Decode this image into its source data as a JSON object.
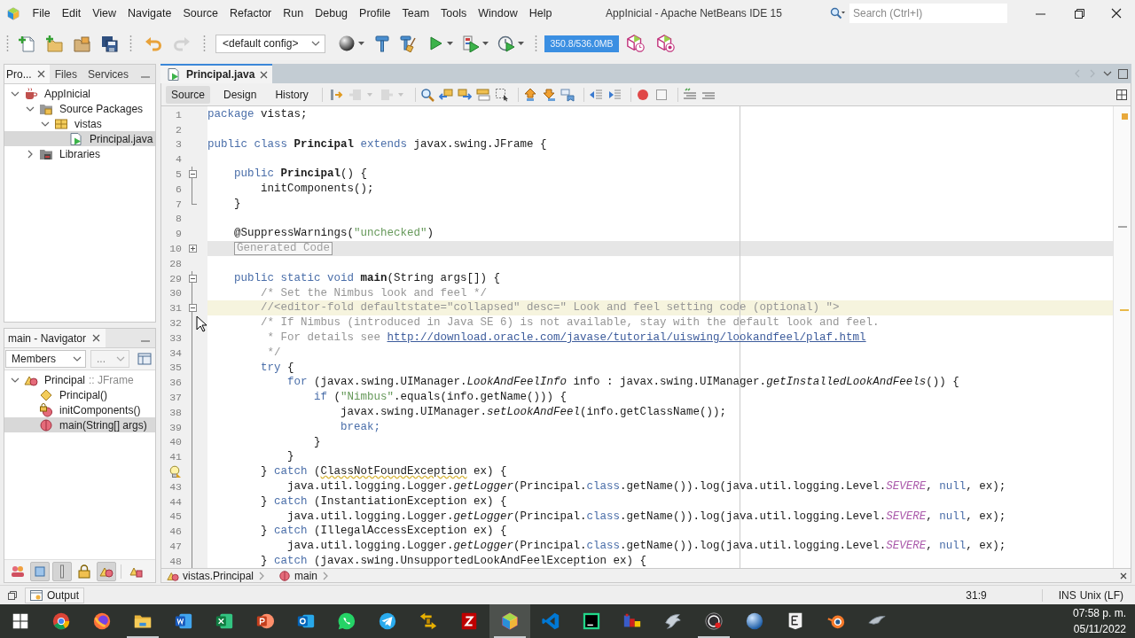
{
  "window": {
    "title": "AppInicial - Apache NetBeans IDE 15",
    "search": {
      "placeholder": "Search (Ctrl+I)"
    }
  },
  "menu": [
    "File",
    "Edit",
    "View",
    "Navigate",
    "Source",
    "Refactor",
    "Run",
    "Debug",
    "Profile",
    "Team",
    "Tools",
    "Window",
    "Help"
  ],
  "toolbar": {
    "buttons": [
      {
        "kind": "newfile",
        "disabled": false
      },
      {
        "kind": "newproject",
        "disabled": false
      },
      {
        "kind": "openproject",
        "disabled": false
      },
      {
        "kind": "saveall",
        "disabled": false
      },
      {
        "kind": "undo",
        "disabled": false
      },
      {
        "kind": "redo",
        "disabled": true
      }
    ],
    "config": "<default config>",
    "actions": [
      {
        "kind": "browser",
        "dropdown": true
      },
      {
        "kind": "build",
        "dropdown": false
      },
      {
        "kind": "cleanbuild",
        "dropdown": false
      },
      {
        "kind": "run",
        "dropdown": true
      },
      {
        "kind": "debug",
        "dropdown": true
      },
      {
        "kind": "profile",
        "dropdown": true
      }
    ],
    "memory": {
      "reading": "350.8/536.0MB",
      "level": 1
    }
  },
  "projects": {
    "tabs": [
      {
        "label": "Pro...",
        "selected": true
      },
      {
        "label": "Files",
        "selected": false
      },
      {
        "label": "Services",
        "selected": false
      }
    ],
    "tree": [
      {
        "label": "AppInicial",
        "kind": "project",
        "expanded": true,
        "selected": false,
        "children": [
          {
            "label": "Source Packages",
            "kind": "sources",
            "expanded": true,
            "selected": false,
            "children": [
              {
                "label": "vistas",
                "kind": "package",
                "expanded": true,
                "selected": false,
                "children": [
                  {
                    "label": "Principal.java",
                    "kind": "file",
                    "selected": true
                  }
                ]
              }
            ]
          },
          {
            "label": "Libraries",
            "kind": "libraries",
            "expanded": false,
            "selected": false
          }
        ]
      }
    ]
  },
  "navigator": {
    "title": "main - Navigator",
    "filter": "Members",
    "scope": "...",
    "tree": [
      {
        "label": "Principal",
        "type": ":: JFrame",
        "kind": "class",
        "expanded": true,
        "selected": false,
        "children": [
          {
            "label": "Principal()",
            "kind": "constructor",
            "selected": false
          },
          {
            "label": "initComponents()",
            "kind": "private-method",
            "selected": false
          },
          {
            "label": "main(String[] args)",
            "kind": "static-method",
            "selected": true
          }
        ]
      }
    ],
    "filters": [
      {
        "kind": "inherited",
        "on": false
      },
      {
        "kind": "fields",
        "on": true
      },
      {
        "kind": "static",
        "on": true
      },
      {
        "kind": "private",
        "on": false
      },
      {
        "kind": "inner",
        "on": true
      },
      {
        "kind": "sort",
        "on": false
      }
    ]
  },
  "editor": {
    "tabs": [
      {
        "label": "Principal.java",
        "selected": true
      }
    ],
    "views": [
      {
        "label": "Source",
        "selected": true
      },
      {
        "label": "Design",
        "selected": false
      },
      {
        "label": "History",
        "selected": false
      }
    ],
    "tools": [
      {
        "kind": "lastedit",
        "disabled": false
      },
      {
        "kind": "back",
        "disabled": true
      },
      {
        "kind": "forward",
        "disabled": true
      },
      {
        "kind": "find",
        "disabled": false
      },
      {
        "kind": "findprev",
        "disabled": false
      },
      {
        "kind": "findnext",
        "disabled": false
      },
      {
        "kind": "highlight",
        "disabled": false
      },
      {
        "kind": "rectselect",
        "disabled": false
      },
      {
        "kind": "prevbookmark",
        "disabled": false
      },
      {
        "kind": "nextbookmark",
        "disabled": false
      },
      {
        "kind": "togglebookmark",
        "disabled": false
      },
      {
        "kind": "shiftleft",
        "disabled": false
      },
      {
        "kind": "shiftright",
        "disabled": false
      },
      {
        "kind": "record",
        "disabled": false
      },
      {
        "kind": "stop",
        "disabled": false
      },
      {
        "kind": "comment",
        "disabled": false
      },
      {
        "kind": "uncomment",
        "disabled": false
      }
    ],
    "lines": [
      {
        "number": "1",
        "current": false,
        "hint": false,
        "tokens": [
          {
            "kind": "keyword",
            "text": "package"
          },
          {
            "kind": "plain",
            "text": " vistas;"
          }
        ]
      },
      {
        "number": "2",
        "current": false,
        "hint": false
      },
      {
        "number": "3",
        "current": false,
        "hint": false,
        "tokens": [
          {
            "kind": "keyword",
            "text": "public class"
          },
          {
            "kind": "bold",
            "text": " Principal"
          },
          {
            "kind": "keyword",
            "text": " extends"
          },
          {
            "kind": "plain",
            "text": " javax.swing.JFrame {"
          }
        ]
      },
      {
        "number": "4",
        "current": false,
        "hint": false
      },
      {
        "number": "5",
        "current": false,
        "hint": false,
        "expanded": true,
        "tokens": [
          {
            "kind": "keyword",
            "text": "    public"
          },
          {
            "kind": "bold",
            "text": " Principal"
          },
          {
            "kind": "plain",
            "text": "() {"
          }
        ]
      },
      {
        "number": "6",
        "current": false,
        "hint": false,
        "tokens": [
          {
            "kind": "plain",
            "text": "        initComponents();"
          }
        ]
      },
      {
        "number": "7",
        "current": false,
        "hint": false,
        "fold_end": true,
        "tokens": [
          {
            "kind": "plain",
            "text": "    }"
          }
        ]
      },
      {
        "number": "8",
        "current": false,
        "hint": false
      },
      {
        "number": "9",
        "current": false,
        "hint": false,
        "tokens": [
          {
            "kind": "plain",
            "text": "    @SuppressWarnings("
          },
          {
            "kind": "string",
            "text": "\"unchecked\""
          },
          {
            "kind": "plain",
            "text": ")"
          }
        ]
      },
      {
        "number": "10",
        "current": false,
        "hint": false,
        "expanded": false,
        "tokens": [
          {
            "kind": "folded",
            "text": "    Generated Code"
          }
        ]
      },
      {
        "number": "28",
        "current": false,
        "hint": false
      },
      {
        "number": "29",
        "current": false,
        "hint": false,
        "expanded": true,
        "tokens": [
          {
            "kind": "keyword",
            "text": "    public static void"
          },
          {
            "kind": "bold",
            "text": " main"
          },
          {
            "kind": "plain",
            "text": "(String args[]) {"
          }
        ]
      },
      {
        "number": "30",
        "current": false,
        "hint": false,
        "tokens": [
          {
            "kind": "comment",
            "text": "        /* Set the Nimbus look and feel */"
          }
        ]
      },
      {
        "number": "31",
        "current": true,
        "hint": false,
        "expanded": true,
        "tokens": [
          {
            "kind": "comment",
            "text": "        //<editor-fold defaultstate=\"collapsed\" desc=\" Look and feel setting code (optional) \">"
          }
        ]
      },
      {
        "number": "32",
        "current": false,
        "hint": false,
        "tokens": [
          {
            "kind": "comment",
            "text": "        /* If Nimbus (introduced in Java SE 6) is not available, stay with the default look and feel."
          }
        ]
      },
      {
        "number": "33",
        "current": false,
        "hint": false,
        "tokens": [
          {
            "kind": "comment",
            "text": "         * For details see "
          },
          {
            "kind": "link",
            "text": "http://download.oracle.com/javase/tutorial/uiswing/lookandfeel/plaf.html"
          }
        ]
      },
      {
        "number": "34",
        "current": false,
        "hint": false,
        "tokens": [
          {
            "kind": "comment",
            "text": "         */"
          }
        ]
      },
      {
        "number": "35",
        "current": false,
        "hint": false,
        "tokens": [
          {
            "kind": "keyword",
            "text": "        try"
          },
          {
            "kind": "plain",
            "text": " {"
          }
        ]
      },
      {
        "number": "36",
        "current": false,
        "hint": false,
        "tokens": [
          {
            "kind": "keyword",
            "text": "            for"
          },
          {
            "kind": "plain",
            "text": " (javax.swing.UIManager."
          },
          {
            "kind": "italic",
            "text": "LookAndFeelInfo"
          },
          {
            "kind": "plain",
            "text": " info : javax.swing.UIManager."
          },
          {
            "kind": "italic",
            "text": "getInstalledLookAndFeels"
          },
          {
            "kind": "plain",
            "text": "()) {"
          }
        ]
      },
      {
        "number": "37",
        "current": false,
        "hint": false,
        "tokens": [
          {
            "kind": "keyword",
            "text": "                if"
          },
          {
            "kind": "plain",
            "text": " ("
          },
          {
            "kind": "string",
            "text": "\"Nimbus\""
          },
          {
            "kind": "plain",
            "text": ".equals(info.getName())) {"
          }
        ]
      },
      {
        "number": "38",
        "current": false,
        "hint": false,
        "tokens": [
          {
            "kind": "plain",
            "text": "                    javax.swing.UIManager."
          },
          {
            "kind": "italic",
            "text": "setLookAndFeel"
          },
          {
            "kind": "plain",
            "text": "(info.getClassName());"
          }
        ]
      },
      {
        "number": "39",
        "current": false,
        "hint": false,
        "tokens": [
          {
            "kind": "keyword",
            "text": "                    break;"
          }
        ]
      },
      {
        "number": "40",
        "current": false,
        "hint": false,
        "tokens": [
          {
            "kind": "plain",
            "text": "                }"
          }
        ]
      },
      {
        "number": "41",
        "current": false,
        "hint": false,
        "tokens": [
          {
            "kind": "plain",
            "text": "            }"
          }
        ]
      },
      {
        "current": false,
        "hint": true,
        "tokens": [
          {
            "kind": "plain",
            "text": "        } "
          },
          {
            "kind": "keyword",
            "text": "catch"
          },
          {
            "kind": "plain",
            "text": " ("
          },
          {
            "kind": "warning",
            "text": "ClassNotFoundException"
          },
          {
            "kind": "plain",
            "text": " ex) {"
          }
        ]
      },
      {
        "number": "43",
        "current": false,
        "hint": false,
        "tokens": [
          {
            "kind": "plain",
            "text": "            java.util.logging.Logger."
          },
          {
            "kind": "italic",
            "text": "getLogger"
          },
          {
            "kind": "plain",
            "text": "(Principal."
          },
          {
            "kind": "keyword",
            "text": "class"
          },
          {
            "kind": "plain",
            "text": ".getName()).log(java.util.logging.Level."
          },
          {
            "kind": "constant",
            "text": "SEVERE"
          },
          {
            "kind": "plain",
            "text": ", "
          },
          {
            "kind": "keyword",
            "text": "null"
          },
          {
            "kind": "plain",
            "text": ", ex);"
          }
        ]
      },
      {
        "number": "44",
        "current": false,
        "hint": false,
        "tokens": [
          {
            "kind": "plain",
            "text": "        } "
          },
          {
            "kind": "keyword",
            "text": "catch"
          },
          {
            "kind": "plain",
            "text": " (InstantiationException ex) {"
          }
        ]
      },
      {
        "number": "45",
        "current": false,
        "hint": false,
        "tokens": [
          {
            "kind": "plain",
            "text": "            java.util.logging.Logger."
          },
          {
            "kind": "italic",
            "text": "getLogger"
          },
          {
            "kind": "plain",
            "text": "(Principal."
          },
          {
            "kind": "keyword",
            "text": "class"
          },
          {
            "kind": "plain",
            "text": ".getName()).log(java.util.logging.Level."
          },
          {
            "kind": "constant",
            "text": "SEVERE"
          },
          {
            "kind": "plain",
            "text": ", "
          },
          {
            "kind": "keyword",
            "text": "null"
          },
          {
            "kind": "plain",
            "text": ", ex);"
          }
        ]
      },
      {
        "number": "46",
        "current": false,
        "hint": false,
        "tokens": [
          {
            "kind": "plain",
            "text": "        } "
          },
          {
            "kind": "keyword",
            "text": "catch"
          },
          {
            "kind": "plain",
            "text": " (IllegalAccessException ex) {"
          }
        ]
      },
      {
        "number": "47",
        "current": false,
        "hint": false,
        "tokens": [
          {
            "kind": "plain",
            "text": "            java.util.logging.Logger."
          },
          {
            "kind": "italic",
            "text": "getLogger"
          },
          {
            "kind": "plain",
            "text": "(Principal."
          },
          {
            "kind": "keyword",
            "text": "class"
          },
          {
            "kind": "plain",
            "text": ".getName()).log(java.util.logging.Level."
          },
          {
            "kind": "constant",
            "text": "SEVERE"
          },
          {
            "kind": "plain",
            "text": ", "
          },
          {
            "kind": "keyword",
            "text": "null"
          },
          {
            "kind": "plain",
            "text": ", ex);"
          }
        ]
      },
      {
        "number": "48",
        "current": false,
        "hint": false,
        "tokens": [
          {
            "kind": "plain",
            "text": "        } "
          },
          {
            "kind": "keyword",
            "text": "catch"
          },
          {
            "kind": "plain",
            "text": " (javax.swing.UnsupportedLookAndFeelException ex) {"
          }
        ]
      }
    ],
    "breadcrumbs": [
      {
        "label": "vistas.Principal",
        "kind": "class"
      },
      {
        "label": "main",
        "kind": "method"
      }
    ]
  },
  "status_bar": {
    "output": "Output",
    "position": "31:9",
    "mode": "INS",
    "line_endings": "Unix (LF)"
  },
  "taskbar": {
    "apps": [
      {
        "kind": "start",
        "selected": false,
        "running": false
      },
      {
        "kind": "ring",
        "selected": false,
        "running": false
      },
      {
        "kind": "fox",
        "selected": false,
        "running": false
      },
      {
        "kind": "folder",
        "selected": false,
        "running": true
      },
      {
        "kind": "wtile",
        "selected": false,
        "running": false
      },
      {
        "kind": "xtile",
        "selected": false,
        "running": false
      },
      {
        "kind": "ptile",
        "selected": false,
        "running": false
      },
      {
        "kind": "otile",
        "selected": false,
        "running": false
      },
      {
        "kind": "chat",
        "selected": false,
        "running": false
      },
      {
        "kind": "plane",
        "selected": false,
        "running": false
      },
      {
        "kind": "arrows",
        "selected": false,
        "running": false
      },
      {
        "kind": "ztile",
        "selected": false,
        "running": false
      },
      {
        "kind": "cube",
        "selected": true,
        "running": true
      },
      {
        "kind": "ribbon",
        "selected": false,
        "running": false
      },
      {
        "kind": "pctile",
        "selected": false,
        "running": false
      },
      {
        "kind": "blocks",
        "selected": false,
        "running": false
      },
      {
        "kind": "bird",
        "selected": false,
        "running": false
      },
      {
        "kind": "record",
        "selected": false,
        "running": true
      },
      {
        "kind": "globe",
        "selected": false,
        "running": false
      },
      {
        "kind": "etile",
        "selected": false,
        "running": false
      },
      {
        "kind": "orb",
        "selected": false,
        "running": false
      },
      {
        "kind": "wing",
        "selected": false,
        "running": false
      }
    ],
    "time": "07:58 p. m.",
    "date": "05/11/2022"
  }
}
